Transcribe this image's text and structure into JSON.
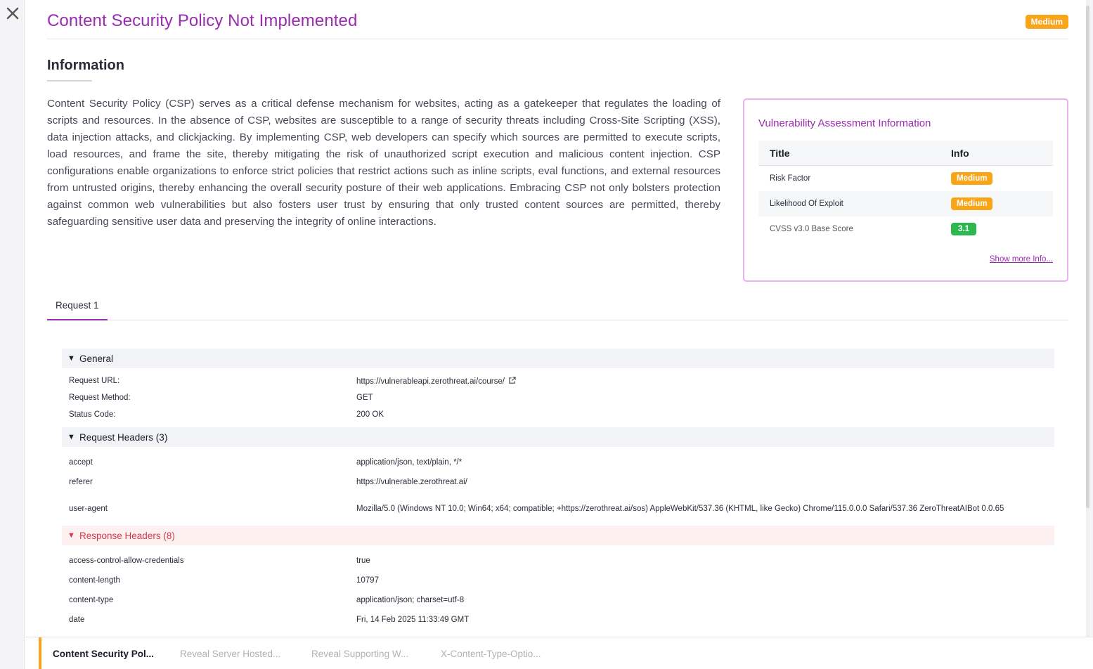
{
  "header": {
    "title": "Content Security Policy Not Implemented",
    "severity": "Medium"
  },
  "information": {
    "heading": "Information",
    "description": "Content Security Policy (CSP) serves as a critical defense mechanism for websites, acting as a gatekeeper that regulates the loading of scripts and resources. In the absence of CSP, websites are susceptible to a range of security threats including Cross-Site Scripting (XSS), data injection attacks, and clickjacking. By implementing CSP, web developers can specify which sources are permitted to execute scripts, load resources, and frame the site, thereby mitigating the risk of unauthorized script execution and malicious content injection. CSP configurations enable organizations to enforce strict policies that restrict actions such as inline scripts, eval functions, and external resources from untrusted origins, thereby enhancing the overall security posture of their web applications. Embracing CSP not only bolsters protection against common web vulnerabilities but also fosters user trust by ensuring that only trusted content sources are permitted, thereby safeguarding sensitive user data and preserving the integrity of online interactions."
  },
  "assessment": {
    "title": "Vulnerability Assessment Information",
    "col_title": "Title",
    "col_info": "Info",
    "rows": [
      {
        "label": "Risk Factor",
        "value": "Medium",
        "color": "#f9a51a"
      },
      {
        "label": "Likelihood Of Exploit",
        "value": "Medium",
        "color": "#f9a51a"
      },
      {
        "label": "CVSS v3.0 Base Score",
        "value": "3.1",
        "color": "#2bb84d"
      }
    ],
    "show_more": "Show more Info..."
  },
  "tabs": {
    "active": "Request 1"
  },
  "request": {
    "general": {
      "heading": "General",
      "rows": [
        {
          "key": "Request URL:",
          "value": "https://vulnerableapi.zerothreat.ai/course/"
        },
        {
          "key": "Request Method:",
          "value": "GET"
        },
        {
          "key": "Status Code:",
          "value": "200 OK"
        }
      ]
    },
    "request_headers": {
      "heading": "Request Headers (3)",
      "rows": [
        {
          "key": "accept",
          "value": "application/json, text/plain, */*"
        },
        {
          "key": "referer",
          "value": "https://vulnerable.zerothreat.ai/"
        },
        {
          "key": "user-agent",
          "value": "Mozilla/5.0 (Windows NT 10.0; Win64; x64; compatible; +https://zerothreat.ai/sos) AppleWebKit/537.36 (KHTML, like Gecko) Chrome/115.0.0.0 Safari/537.36 ZeroThreatAIBot 0.0.65"
        }
      ]
    },
    "response_headers": {
      "heading": "Response Headers (8)",
      "rows": [
        {
          "key": "access-control-allow-credentials",
          "value": "true"
        },
        {
          "key": "content-length",
          "value": "10797"
        },
        {
          "key": "content-type",
          "value": "application/json; charset=utf-8"
        },
        {
          "key": "date",
          "value": "Fri, 14 Feb 2025 11:33:49 GMT"
        }
      ]
    }
  },
  "bottom_tabs": [
    {
      "label": "Content Security Pol...",
      "active": true
    },
    {
      "label": "Reveal Server Hosted...",
      "active": false
    },
    {
      "label": "Reveal Supporting W...",
      "active": false
    },
    {
      "label": "X-Content-Type-Optio...",
      "active": false
    }
  ],
  "colors": {
    "accent": "#9b2bb0",
    "medium": "#f9a51a",
    "low": "#2bb84d",
    "response_header": "#d23a4a"
  }
}
